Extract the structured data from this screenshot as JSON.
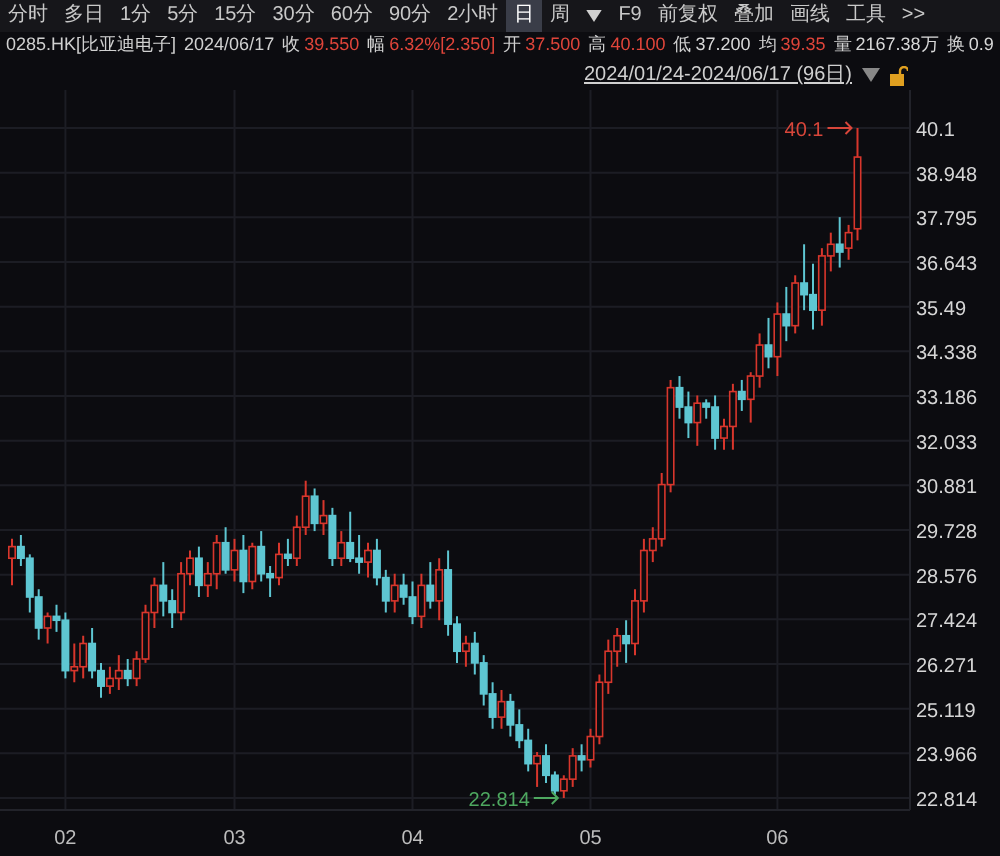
{
  "toolbar": {
    "tabs": [
      {
        "label": "分时",
        "selected": false
      },
      {
        "label": "多日",
        "selected": false
      },
      {
        "label": "1分",
        "selected": false
      },
      {
        "label": "5分",
        "selected": false
      },
      {
        "label": "15分",
        "selected": false
      },
      {
        "label": "30分",
        "selected": false
      },
      {
        "label": "60分",
        "selected": false
      },
      {
        "label": "90分",
        "selected": false
      },
      {
        "label": "2小时",
        "selected": false
      },
      {
        "label": "日",
        "selected": true
      },
      {
        "label": "周",
        "selected": false
      }
    ],
    "tools": [
      "F9",
      "前复权",
      "叠加",
      "画线",
      "工具",
      ">>"
    ]
  },
  "quote": {
    "symbol": "0285.HK[比亚迪电子]",
    "date": "2024/06/17",
    "fields": [
      {
        "label": "收",
        "value": "39.550",
        "color": "#e0453a"
      },
      {
        "label": "幅",
        "value": "6.32%[2.350]",
        "color": "#e0453a"
      },
      {
        "label": "开",
        "value": "37.500",
        "color": "#e0453a"
      },
      {
        "label": "高",
        "value": "40.100",
        "color": "#e0453a"
      },
      {
        "label": "低",
        "value": "37.200",
        "color": "#d8d8d8"
      },
      {
        "label": "均",
        "value": "39.35",
        "color": "#e0453a"
      },
      {
        "label": "量",
        "value": "2167.38万",
        "color": "#d8d8d8"
      },
      {
        "label": "换",
        "value": "0.9",
        "color": "#d8d8d8"
      }
    ]
  },
  "date_range": "2024/01/24-2024/06/17 (96日)",
  "chart": {
    "chart_data": {
      "type": "candlestick",
      "ylim": [
        22.814,
        40.1
      ],
      "yticks": [
        40.1,
        38.948,
        37.795,
        36.643,
        35.49,
        34.338,
        33.186,
        32.033,
        30.881,
        29.728,
        28.576,
        27.424,
        26.271,
        25.119,
        23.966,
        22.814
      ],
      "grid": true,
      "categories": [
        null,
        null,
        null,
        null,
        null,
        null,
        "02",
        null,
        null,
        null,
        null,
        null,
        null,
        null,
        null,
        null,
        null,
        null,
        null,
        null,
        null,
        null,
        null,
        null,
        null,
        "03",
        null,
        null,
        null,
        null,
        null,
        null,
        null,
        null,
        null,
        null,
        null,
        null,
        null,
        null,
        null,
        null,
        null,
        null,
        null,
        "04",
        null,
        null,
        null,
        null,
        null,
        null,
        null,
        null,
        null,
        null,
        null,
        null,
        null,
        null,
        null,
        null,
        null,
        null,
        null,
        "05",
        null,
        null,
        null,
        null,
        null,
        null,
        null,
        null,
        null,
        null,
        null,
        null,
        null,
        null,
        null,
        null,
        null,
        null,
        null,
        null,
        "06",
        null,
        null,
        null,
        null,
        null,
        null,
        null,
        null,
        null
      ],
      "annotations": [
        "40.1",
        "22.814"
      ],
      "ohlc": [
        [
          29.0,
          29.5,
          28.3,
          29.3
        ],
        [
          29.3,
          29.6,
          28.8,
          29.0
        ],
        [
          29.0,
          29.1,
          27.6,
          28.0
        ],
        [
          28.0,
          28.2,
          26.9,
          27.2
        ],
        [
          27.2,
          27.6,
          26.8,
          27.5
        ],
        [
          27.5,
          27.8,
          27.1,
          27.4
        ],
        [
          27.4,
          27.6,
          25.9,
          26.1
        ],
        [
          26.1,
          26.8,
          25.8,
          26.2
        ],
        [
          26.2,
          27.0,
          25.9,
          26.8
        ],
        [
          26.8,
          27.2,
          25.9,
          26.1
        ],
        [
          26.1,
          26.3,
          25.4,
          25.7
        ],
        [
          25.7,
          26.2,
          25.5,
          25.9
        ],
        [
          25.9,
          26.5,
          25.6,
          26.1
        ],
        [
          26.1,
          26.4,
          25.7,
          25.9
        ],
        [
          25.9,
          26.6,
          25.7,
          26.4
        ],
        [
          26.4,
          27.8,
          26.3,
          27.6
        ],
        [
          27.6,
          28.5,
          27.2,
          28.3
        ],
        [
          28.3,
          28.9,
          27.5,
          27.9
        ],
        [
          27.9,
          28.2,
          27.2,
          27.6
        ],
        [
          27.6,
          28.9,
          27.4,
          28.6
        ],
        [
          28.6,
          29.2,
          28.3,
          29.0
        ],
        [
          29.0,
          29.3,
          28.0,
          28.3
        ],
        [
          28.3,
          28.9,
          28.0,
          28.6
        ],
        [
          28.6,
          29.6,
          28.2,
          29.4
        ],
        [
          29.4,
          29.8,
          28.6,
          28.7
        ],
        [
          28.7,
          29.5,
          28.4,
          29.2
        ],
        [
          29.2,
          29.6,
          28.1,
          28.4
        ],
        [
          28.4,
          29.4,
          28.2,
          29.3
        ],
        [
          29.3,
          29.7,
          28.4,
          28.6
        ],
        [
          28.6,
          28.8,
          28.0,
          28.5
        ],
        [
          28.5,
          29.4,
          28.3,
          29.1
        ],
        [
          29.1,
          29.5,
          28.8,
          29.0
        ],
        [
          29.0,
          30.1,
          28.8,
          29.8
        ],
        [
          29.8,
          31.0,
          29.6,
          30.6
        ],
        [
          30.6,
          30.8,
          29.7,
          29.9
        ],
        [
          29.9,
          30.5,
          29.6,
          30.1
        ],
        [
          30.1,
          30.3,
          28.8,
          29.0
        ],
        [
          29.0,
          29.7,
          28.8,
          29.4
        ],
        [
          29.4,
          30.2,
          28.9,
          29.0
        ],
        [
          29.0,
          29.6,
          28.6,
          28.9
        ],
        [
          28.9,
          29.4,
          28.5,
          29.2
        ],
        [
          29.2,
          29.5,
          28.3,
          28.5
        ],
        [
          28.5,
          28.7,
          27.6,
          27.9
        ],
        [
          27.9,
          28.6,
          27.6,
          28.3
        ],
        [
          28.3,
          28.6,
          27.8,
          28.0
        ],
        [
          28.0,
          28.4,
          27.3,
          27.5
        ],
        [
          27.5,
          28.6,
          27.2,
          28.3
        ],
        [
          28.3,
          28.9,
          27.7,
          27.9
        ],
        [
          27.9,
          29.0,
          27.4,
          28.7
        ],
        [
          28.7,
          29.2,
          27.0,
          27.3
        ],
        [
          27.3,
          27.5,
          26.3,
          26.6
        ],
        [
          26.6,
          27.0,
          26.2,
          26.8
        ],
        [
          26.8,
          27.1,
          26.0,
          26.3
        ],
        [
          26.3,
          26.5,
          25.2,
          25.5
        ],
        [
          25.5,
          25.8,
          24.6,
          24.9
        ],
        [
          24.9,
          25.6,
          24.6,
          25.3
        ],
        [
          25.3,
          25.5,
          24.4,
          24.7
        ],
        [
          24.7,
          25.1,
          24.1,
          24.3
        ],
        [
          24.3,
          24.6,
          23.5,
          23.7
        ],
        [
          23.7,
          24.0,
          23.1,
          23.9
        ],
        [
          23.9,
          24.2,
          23.2,
          23.4
        ],
        [
          23.4,
          23.5,
          22.9,
          23.0
        ],
        [
          23.0,
          23.4,
          22.814,
          23.3
        ],
        [
          23.3,
          24.1,
          23.1,
          23.9
        ],
        [
          23.9,
          24.2,
          23.5,
          23.8
        ],
        [
          23.8,
          24.6,
          23.6,
          24.4
        ],
        [
          24.4,
          26.0,
          24.2,
          25.8
        ],
        [
          25.8,
          26.9,
          25.5,
          26.6
        ],
        [
          26.6,
          27.2,
          26.2,
          27.0
        ],
        [
          27.0,
          27.4,
          26.3,
          26.8
        ],
        [
          26.8,
          28.2,
          26.5,
          27.9
        ],
        [
          27.9,
          29.5,
          27.6,
          29.2
        ],
        [
          29.2,
          29.8,
          28.9,
          29.5
        ],
        [
          29.5,
          31.2,
          29.3,
          30.9
        ],
        [
          30.9,
          33.6,
          30.7,
          33.4
        ],
        [
          33.4,
          33.7,
          32.6,
          32.9
        ],
        [
          32.9,
          33.3,
          32.1,
          32.5
        ],
        [
          32.5,
          33.2,
          31.9,
          33.0
        ],
        [
          33.0,
          33.1,
          32.6,
          32.9
        ],
        [
          32.9,
          33.2,
          31.8,
          32.1
        ],
        [
          32.1,
          32.6,
          31.8,
          32.4
        ],
        [
          32.4,
          33.5,
          31.8,
          33.3
        ],
        [
          33.3,
          33.6,
          32.8,
          33.1
        ],
        [
          33.1,
          33.8,
          32.5,
          33.7
        ],
        [
          33.7,
          34.8,
          33.4,
          34.5
        ],
        [
          34.5,
          35.2,
          33.9,
          34.2
        ],
        [
          34.2,
          35.6,
          33.7,
          35.3
        ],
        [
          35.3,
          36.0,
          34.6,
          35.0
        ],
        [
          35.0,
          36.3,
          34.8,
          36.1
        ],
        [
          36.1,
          37.1,
          35.4,
          35.8
        ],
        [
          35.8,
          36.6,
          34.9,
          35.4
        ],
        [
          35.4,
          37.0,
          35.0,
          36.8
        ],
        [
          36.8,
          37.4,
          36.4,
          37.1
        ],
        [
          37.1,
          37.8,
          36.5,
          36.9
        ],
        [
          37.0,
          37.6,
          36.7,
          37.4
        ],
        [
          37.5,
          40.1,
          37.2,
          39.35
        ]
      ]
    }
  }
}
